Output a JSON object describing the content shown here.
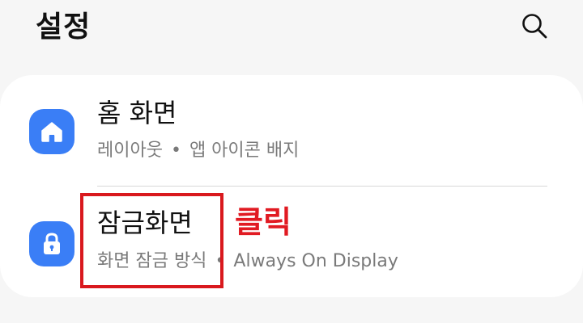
{
  "header": {
    "title": "설정",
    "search_icon": "search-icon"
  },
  "items": [
    {
      "title": "홈 화면",
      "subtitle_parts": [
        "레이아웃",
        "앱 아이콘 배지"
      ],
      "separator": "•",
      "icon": "home-icon",
      "icon_color": "#3a7ef6"
    },
    {
      "title": "잠금화면",
      "subtitle_parts": [
        "화면 잠금 방식",
        "Always On Display"
      ],
      "separator": "•",
      "icon": "lock-icon",
      "icon_color": "#3a7ef6"
    }
  ],
  "annotation": {
    "text": "클릭",
    "color": "#e11a22"
  }
}
